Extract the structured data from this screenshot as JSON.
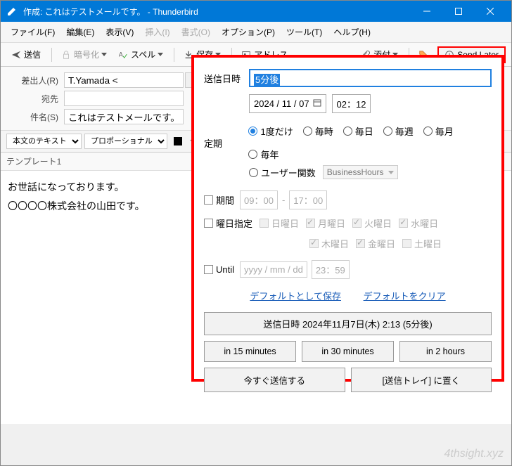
{
  "window": {
    "title": "作成: これはテストメールです。 - Thunderbird"
  },
  "menu": {
    "file": "ファイル(F)",
    "edit": "編集(E)",
    "view": "表示(V)",
    "insert": "挿入(I)",
    "format": "書式(O)",
    "options": "オプション(P)",
    "tools": "ツール(T)",
    "help": "ヘルプ(H)"
  },
  "toolbar": {
    "send": "送信",
    "encrypt": "暗号化",
    "spell": "スペル",
    "save": "保存",
    "address": "アドレス",
    "attach": "添付",
    "sendlater": "Send Later"
  },
  "headers": {
    "from_label": "差出人(R)",
    "from_value": "T.Yamada <",
    "to_label": "宛先",
    "subject_label": "件名(S)",
    "subject_value": "これはテストメールです。"
  },
  "format": {
    "body_text": "本文のテキスト",
    "font": "プロポーショナル"
  },
  "templates_label": "テンプレート1",
  "body": {
    "line1": "お世話になっております。",
    "line2": "〇〇〇〇株式会社の山田です。"
  },
  "panel": {
    "send_time_label": "送信日時",
    "send_time_value": "5分後",
    "date_value": "2024 / 11 / 07",
    "time_value": "02：12",
    "recur_label": "定期",
    "recur_once": "1度だけ",
    "recur_hourly": "毎時",
    "recur_daily": "毎日",
    "recur_weekly": "毎週",
    "recur_monthly": "毎月",
    "recur_yearly": "毎年",
    "recur_user": "ユーザー関数",
    "user_func": "BusinessHours",
    "period_label": "期間",
    "period_start": "09：00",
    "period_sep": "-",
    "period_end": "17：00",
    "days_label": "曜日指定",
    "sun": "日曜日",
    "mon": "月曜日",
    "tue": "火曜日",
    "wed": "水曜日",
    "thu": "木曜日",
    "fri": "金曜日",
    "sat": "土曜日",
    "until_label": "Until",
    "until_date": "yyyy / mm / dd",
    "until_time": "23：59",
    "save_default": "デフォルトとして保存",
    "clear_default": "デフォルトをクリア",
    "summary": "送信日時 2024年11月7日(木) 2:13 (5分後)",
    "btn_15": "in 15 minutes",
    "btn_30": "in 30 minutes",
    "btn_2h": "in 2 hours",
    "btn_now": "今すぐ送信する",
    "btn_outbox": "[送信トレイ] に置く"
  },
  "watermark": "4thsight.xyz"
}
